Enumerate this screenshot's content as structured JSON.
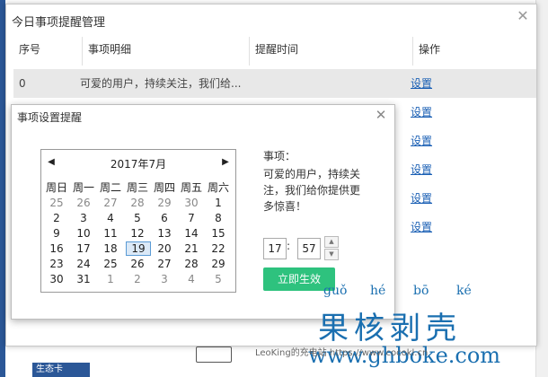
{
  "main": {
    "title": "今日事项提醒管理",
    "columns": [
      "序号",
      "事项明细",
      "提醒时间",
      "操作"
    ],
    "rows": [
      {
        "index": "0",
        "detail": "可爱的用户，持续关注，我们给...",
        "time": "",
        "action": "设置"
      },
      {
        "action": "设置"
      },
      {
        "action": "设置"
      },
      {
        "action": "设置"
      },
      {
        "action": "设置"
      },
      {
        "action": "设置"
      }
    ]
  },
  "dialog": {
    "title": "事项设置提醒",
    "calendar": {
      "month_label": "2017年7月",
      "weekdays": [
        "周日",
        "周一",
        "周二",
        "周三",
        "周四",
        "周五",
        "周六"
      ],
      "weeks": [
        [
          "25",
          "26",
          "27",
          "28",
          "29",
          "30",
          "1"
        ],
        [
          "2",
          "3",
          "4",
          "5",
          "6",
          "7",
          "8"
        ],
        [
          "9",
          "10",
          "11",
          "12",
          "13",
          "14",
          "15"
        ],
        [
          "16",
          "17",
          "18",
          "19",
          "20",
          "21",
          "22"
        ],
        [
          "23",
          "24",
          "25",
          "26",
          "27",
          "28",
          "29"
        ],
        [
          "30",
          "31",
          "1",
          "2",
          "3",
          "4",
          "5"
        ]
      ],
      "selected": "19"
    },
    "item_label": "事项：",
    "item_text": "可爱的用户，持续关注，我们给你提供更多惊喜！",
    "hour": "17",
    "minute": "57",
    "apply_label": "立即生效"
  },
  "watermark": {
    "pinyin": [
      "guǒ",
      "hé",
      "bō",
      "ké"
    ],
    "chinese": "果核剥壳",
    "url": "www.ghboke.com",
    "small": "LeoKing的充电站 https://www.cocokl.cn"
  },
  "taskbar": {
    "label": "生态卡"
  }
}
